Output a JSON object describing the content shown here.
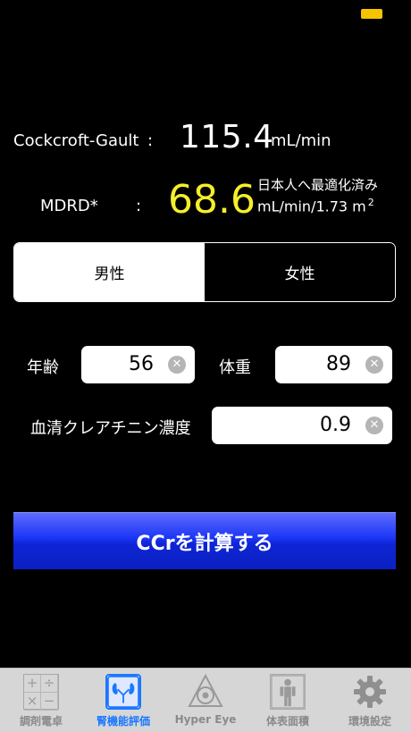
{
  "results": {
    "cg_label": "Cockcroft-Gault",
    "cg_colon": ":",
    "cg_value": "115.4",
    "cg_unit": "mL/min",
    "mdrd_label": "MDRD*",
    "mdrd_colon": ":",
    "mdrd_value": "68.6",
    "mdrd_note": "日本人へ最適化済み",
    "mdrd_unit": "mL/min/1.73 m",
    "mdrd_unit_sup": "2",
    "mdrd_value_color": "#f5ee2c"
  },
  "gender": {
    "male": "男性",
    "female": "女性",
    "selected": "male"
  },
  "inputs": {
    "age_label": "年齢",
    "age_value": "56",
    "weight_label": "体重",
    "weight_value": "89",
    "creatinine_label": "血清クレアチニン濃度",
    "creatinine_value": "0.9",
    "clear_glyph": "✕"
  },
  "calc_button": {
    "label": "CCrを計算する",
    "color": "#1a34f5"
  },
  "tabbar": {
    "tabs": [
      {
        "label": "調剤電卓",
        "icon": "calculator-icon"
      },
      {
        "label": "腎機能評価",
        "icon": "kidney-icon",
        "active": true
      },
      {
        "label": "Hyper Eye",
        "icon": "eye-triangle-icon"
      },
      {
        "label": "体表面積",
        "icon": "body-surface-icon"
      },
      {
        "label": "環境設定",
        "icon": "gear-icon"
      }
    ],
    "calc_glyphs": [
      "+",
      "÷",
      "×",
      "−"
    ],
    "active_color": "#1a78ff"
  },
  "status": {
    "battery_color": "#f5c400"
  }
}
